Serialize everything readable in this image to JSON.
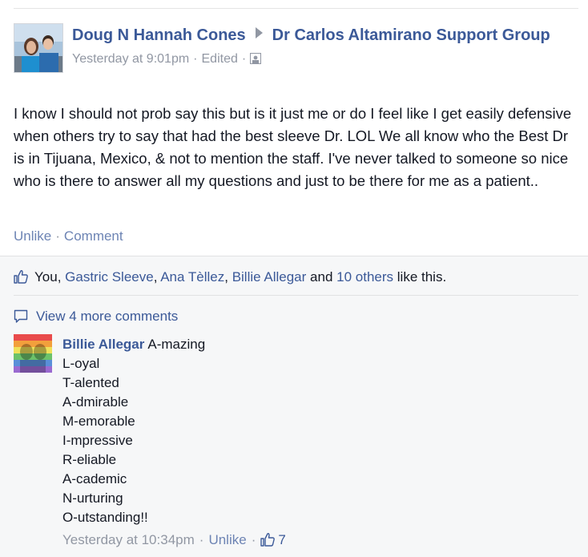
{
  "post": {
    "author": "Doug N Hannah Cones",
    "group": "Dr Carlos Altamirano Support Group",
    "timestamp": "Yesterday at 9:01pm",
    "edited": "Edited",
    "audience_icon": "group-audience-icon",
    "body": "I know I should not prob say this but is it just me or do I feel like I get easily defensive when others try to say that had the best sleeve Dr. LOL We all know who the Best Dr is in Tijuana, Mexico, & not to mention the staff. I've never talked to someone so nice who is there to answer all my questions and just to be there for me as a patient..",
    "actions": {
      "unlike": "Unlike",
      "comment": "Comment"
    }
  },
  "likes": {
    "you": "You,",
    "names": [
      "Gastric Sleeve",
      "Ana Tèllez",
      "Billie Allegar"
    ],
    "and": "and",
    "others": "10 others",
    "suffix": "like this."
  },
  "view_more_comments": "View 4 more comments",
  "comment": {
    "author": "Billie Allegar",
    "first_line": "A-mazing",
    "lines": [
      "L-oyal",
      "T-alented",
      "A-dmirable",
      "M-emorable",
      "I-mpressive",
      "R-eliable",
      "A-cademic",
      "N-urturing",
      "O-utstanding!!"
    ],
    "timestamp": "Yesterday at 10:34pm",
    "unlike": "Unlike",
    "like_count": "7"
  },
  "colors": {
    "link": "#3b5998",
    "action_link": "#6d84b4",
    "meta": "#9197a3",
    "ufi_bg": "#f6f7f8"
  }
}
